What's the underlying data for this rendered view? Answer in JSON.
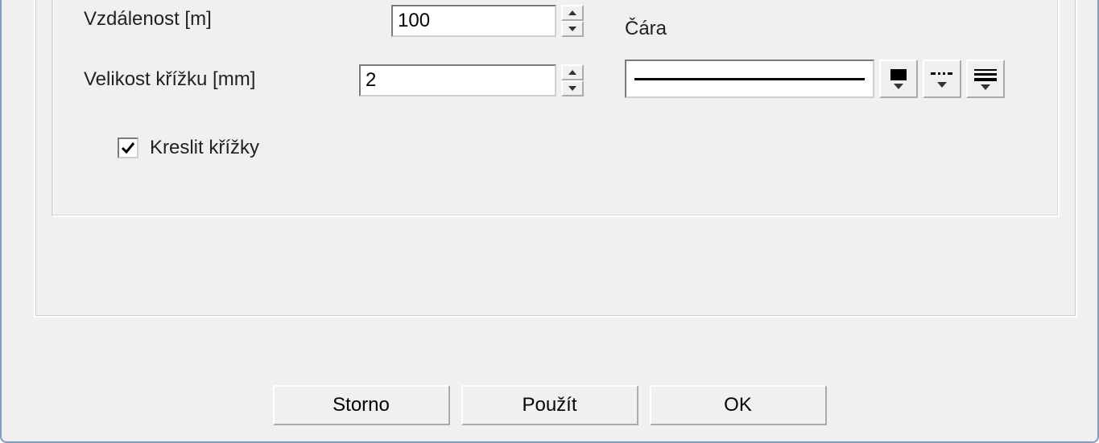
{
  "fields": {
    "distance": {
      "label": "Vzdálenost [m]",
      "value": "100"
    },
    "crossSize": {
      "label": "Velikost křížku [mm]",
      "value": "2"
    }
  },
  "lineSection": {
    "label": "Čára"
  },
  "checkbox": {
    "label": "Kreslit křížky",
    "checked": true
  },
  "buttons": {
    "cancel": "Storno",
    "apply": "Použít",
    "ok": "OK"
  }
}
